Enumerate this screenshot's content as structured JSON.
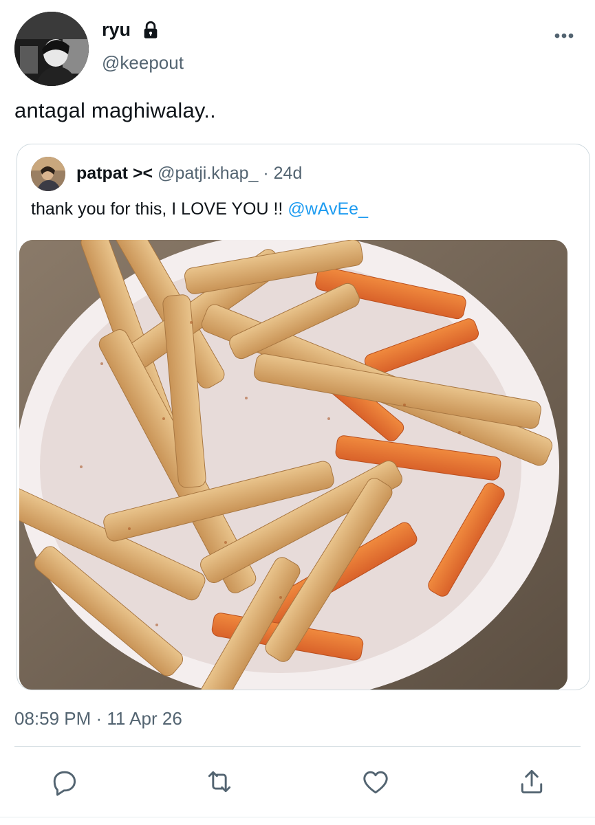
{
  "tweet": {
    "author_name": "ryu",
    "author_handle": "@keepout",
    "text": "antagal maghiwalay..",
    "timestamp": "08:59 PM · 11 Apr 26"
  },
  "quoted": {
    "author_name": "patpat ><",
    "author_handle": "@patji.khap_",
    "age": "· 24d",
    "text": "thank you for this, I LOVE YOU !! ",
    "mention": "@wAvEe_"
  },
  "icons": {
    "lock": "lock-icon",
    "more": "more-icon",
    "reply": "reply-icon",
    "retweet": "retweet-icon",
    "like": "heart-icon",
    "share": "share-icon"
  },
  "colors": {
    "text": "#0f1419",
    "secondary": "#536471",
    "link": "#1d9bf0",
    "border": "#cfd9de"
  }
}
